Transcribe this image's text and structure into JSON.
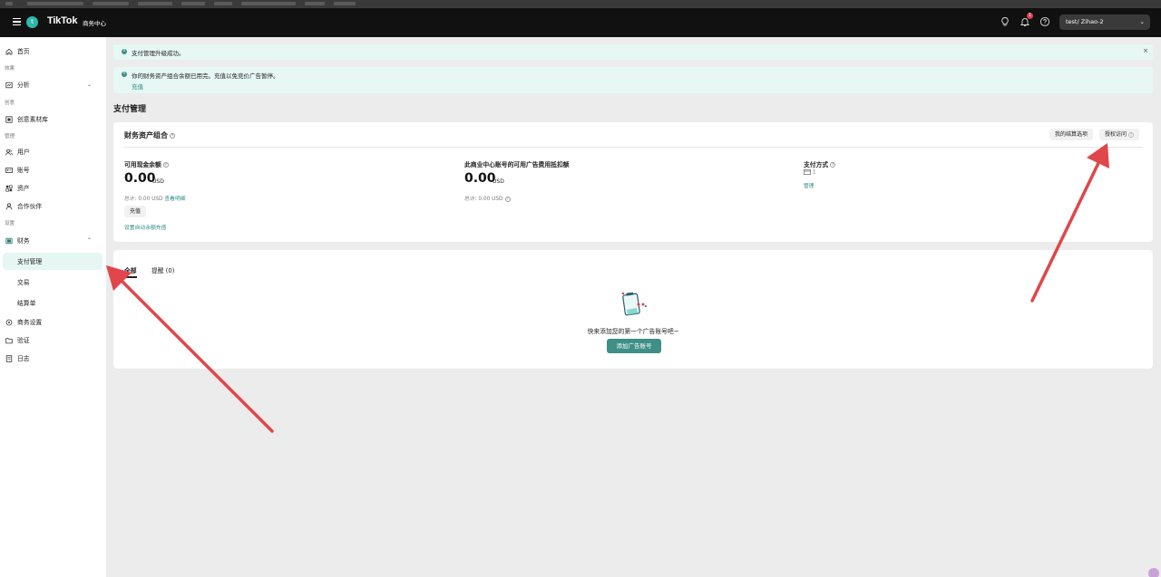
{
  "topbar": {
    "logo": "TikTok",
    "logo_sub": "商务中心",
    "avatar_letter": "t",
    "notification_count": "1",
    "account_name": "test/ Zihao-2"
  },
  "sidebar": {
    "home": "首页",
    "group_effect": "效果",
    "analytics": "分析",
    "group_creative": "创意",
    "creative_library": "创意素材库",
    "group_manage": "管理",
    "users": "用户",
    "accounts": "账号",
    "assets": "资产",
    "partners": "合作伙伴",
    "group_settings": "设置",
    "finance": "财务",
    "payment_management": "支付管理",
    "transactions": "交易",
    "statements": "结算单",
    "business_settings": "商务设置",
    "verification": "验证",
    "logs": "日志"
  },
  "notices": {
    "upgrade_success": "支付管理升级成功。",
    "balance_used_up": "你的财务资产组合余额已用完。充值以免竞价广告暂停。",
    "recharge_link": "充值"
  },
  "page": {
    "title": "支付管理"
  },
  "portfolio": {
    "title": "财务资产组合",
    "billing_options_button": "我的结算选项",
    "authorize_access_button": "授权访问",
    "cash_balance_label": "可用现金余额",
    "cash_balance_value": "0.00",
    "cash_balance_unit": "USD",
    "cash_total": "总计: 0.00 USD",
    "view_details_link": "查看明细",
    "recharge_button": "充值",
    "auto_recharge_link": "设置自动余额充值",
    "deduction_label": "此商业中心账号的可用广告费用抵扣额",
    "deduction_value": "0.00",
    "deduction_unit": "USD",
    "deduction_total": "总计: 0.00 USD",
    "payment_method_label": "支付方式",
    "payment_method_count": "1",
    "manage_link": "管理"
  },
  "ad_accounts": {
    "tab_all": "全部",
    "tab_reminders": "提醒 (0)",
    "empty_text": "快来添加您的第一个广告账号吧~",
    "add_button": "添加广告账号"
  },
  "colors": {
    "accent": "#3e8f86",
    "topbar": "#111111",
    "notice_bg": "#e6f7f4",
    "annotation_arrow": "#e0464a"
  }
}
